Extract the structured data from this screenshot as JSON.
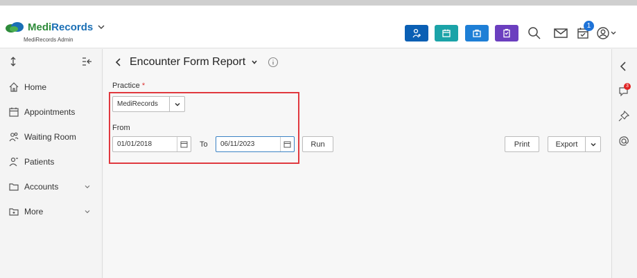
{
  "app": {
    "name": "MediRecords",
    "role": "MediRecords Admin"
  },
  "header": {
    "notifications_count": "1",
    "quick_buttons": [
      {
        "icon": "add-patient-icon",
        "color": "#0a5fb4"
      },
      {
        "icon": "calendar-icon",
        "color": "#1ba3a8"
      },
      {
        "icon": "medical-kit-icon",
        "color": "#1e7fd6"
      },
      {
        "icon": "clipboard-icon",
        "color": "#6b3fbf"
      }
    ]
  },
  "sidebar": {
    "items": [
      {
        "label": "Home",
        "icon": "home-icon"
      },
      {
        "label": "Appointments",
        "icon": "calendar-icon"
      },
      {
        "label": "Waiting Room",
        "icon": "waiting-room-icon"
      },
      {
        "label": "Patients",
        "icon": "patients-icon"
      },
      {
        "label": "Accounts",
        "icon": "folder-icon"
      },
      {
        "label": "More",
        "icon": "more-icon"
      }
    ]
  },
  "report": {
    "title": "Encounter Form Report",
    "practice_label": "Practice",
    "required_mark": "*",
    "practice_value": "MediRecords",
    "from_label": "From",
    "from_value": "01/01/2018",
    "to_label": "To",
    "to_value": "06/11/2023",
    "run_label": "Run",
    "print_label": "Print",
    "export_label": "Export"
  },
  "rightbar": {
    "chat_count": "3"
  }
}
